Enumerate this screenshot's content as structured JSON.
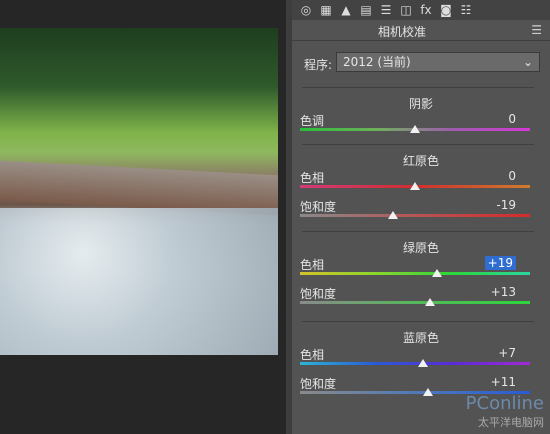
{
  "toolbar_icons": [
    "aperture-icon",
    "grid-icon",
    "mountain-icon",
    "split-tone-icon",
    "lines-icon",
    "lens-icon",
    "fx-icon",
    "camera-icon",
    "sliders-icon"
  ],
  "toolbar_glyphs": [
    "◎",
    "▦",
    "▲",
    "▤",
    "☰",
    "◫",
    "fx",
    "◙",
    "☷"
  ],
  "header": {
    "title": "相机校准",
    "menu": "☰"
  },
  "process": {
    "label": "程序:",
    "value": "2012 (当前)",
    "caret": "⌄"
  },
  "sections": [
    {
      "title": "阴影",
      "rows": [
        {
          "label": "色调",
          "value": "0",
          "fraction": 0.5,
          "gradient": "linear-gradient(90deg,#27c03a,#6fb15a,#a05ab0,#d638d8)"
        }
      ]
    },
    {
      "title": "红原色",
      "rows": [
        {
          "label": "色相",
          "value": "0",
          "fraction": 0.5,
          "gradient": "linear-gradient(90deg,#d33a7a,#cf2f2f,#cf7b2b)"
        },
        {
          "label": "饱和度",
          "value": "-19",
          "fraction": 0.405,
          "gradient": "linear-gradient(90deg,#8a8a8a,#b65555,#d42b2b)"
        }
      ]
    },
    {
      "title": "绿原色",
      "rows": [
        {
          "label": "色相",
          "value": "+19",
          "fraction": 0.595,
          "gradient": "linear-gradient(90deg,#d4c22b,#8bd62b,#2bd63b,#2bd6a0)",
          "highlight": true
        },
        {
          "label": "饱和度",
          "value": "+13",
          "fraction": 0.565,
          "gradient": "linear-gradient(90deg,#8a8a8a,#56b85c,#2bd63b)"
        }
      ]
    },
    {
      "title": "蓝原色",
      "rows": [
        {
          "label": "色相",
          "value": "+7",
          "fraction": 0.535,
          "gradient": "linear-gradient(90deg,#2bb4d6,#2b5ad6,#5b2bd6,#a02bd6)"
        },
        {
          "label": "饱和度",
          "value": "+11",
          "fraction": 0.555,
          "gradient": "linear-gradient(90deg,#8a8a8a,#4f7ab8,#2b5ad6)"
        }
      ]
    }
  ],
  "watermark": {
    "brand": "PConline",
    "sub": "太平洋电脑网"
  }
}
